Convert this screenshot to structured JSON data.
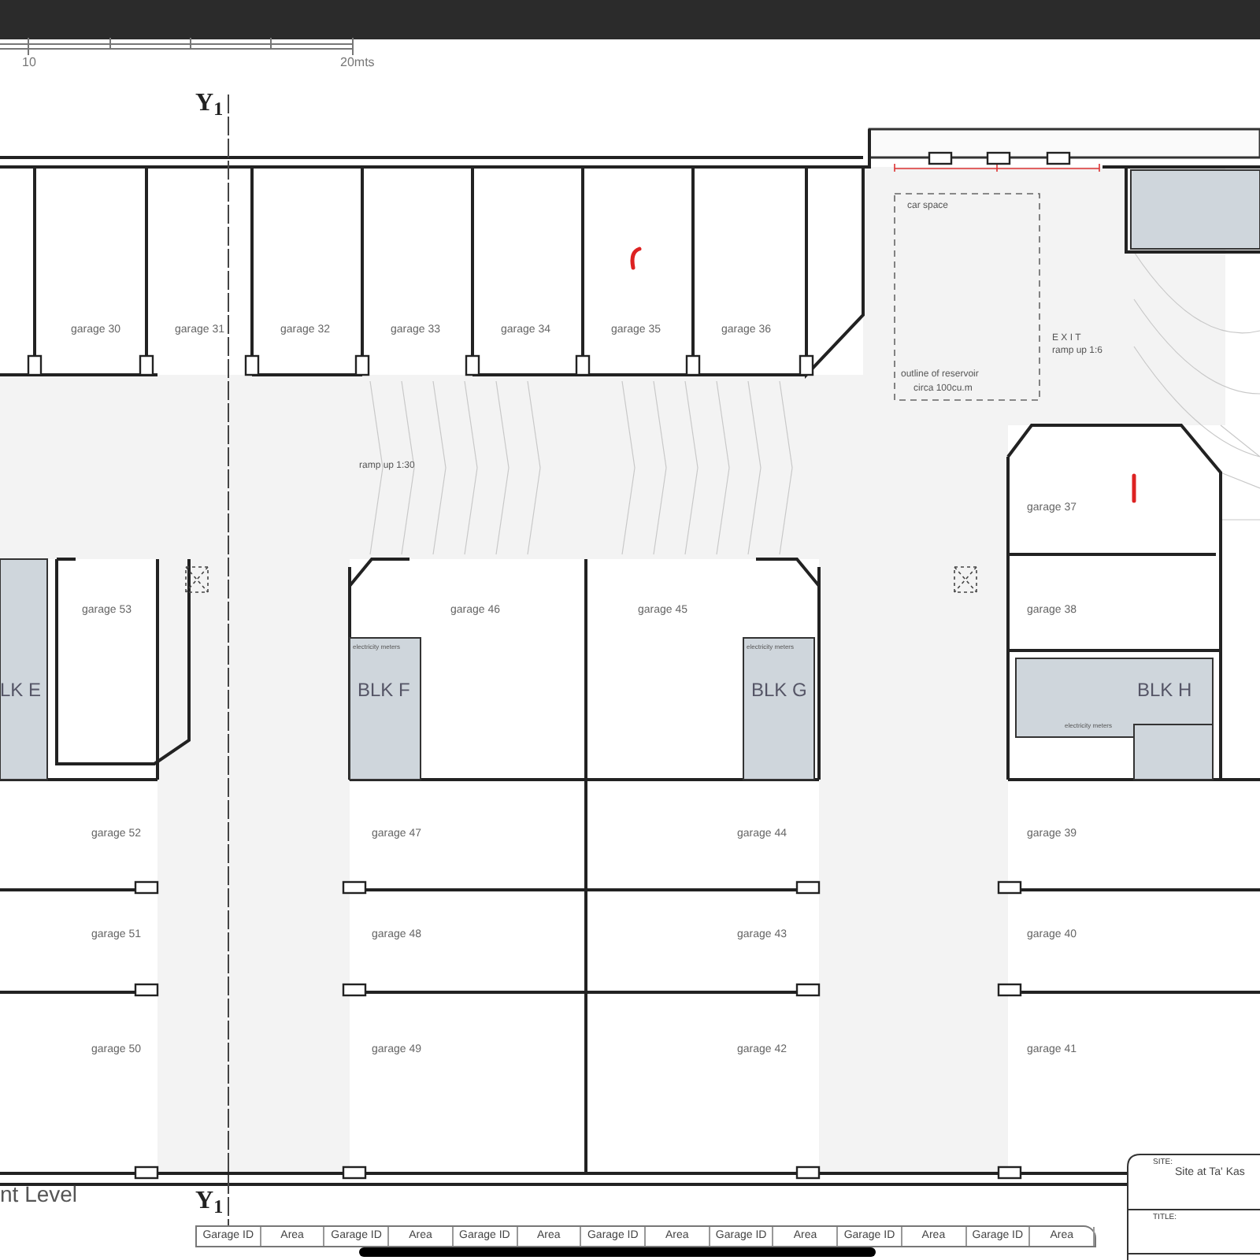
{
  "scale_bar": {
    "labels": [
      "10",
      "20mts"
    ]
  },
  "axis_markers": [
    "Y$_{1}$",
    "Y$_{1}$"
  ],
  "garages": [
    "garage 30",
    "garage 31",
    "garage 32",
    "garage 33",
    "garage 34",
    "garage 35",
    "garage 36",
    "garage 37",
    "garage 53",
    "garage 46",
    "garage 45",
    "garage 38",
    "garage 52",
    "garage 47",
    "garage 44",
    "garage 39",
    "garage 51",
    "garage 48",
    "garage 43",
    "garage 40",
    "garage 50",
    "garage 49",
    "garage 42",
    "garage 41"
  ],
  "blocks": [
    "LK E",
    "BLK F",
    "BLK G",
    "BLK H"
  ],
  "notes": [
    "ramp up 1:30",
    "car space",
    "outline of reservoir",
    "circa 100cu.m",
    "E X I T",
    "ramp up 1:6",
    "electricity meters",
    "electricity meters",
    "electricity meters"
  ],
  "level_title": "nt Level",
  "area_table": {
    "columns": [
      "Garage ID",
      "Area",
      "Garage ID",
      "Area",
      "Garage ID",
      "Area",
      "Garage ID",
      "Area",
      "Garage ID",
      "Area",
      "Garage ID",
      "Area",
      "Garage ID",
      "Area"
    ]
  },
  "title_block": {
    "fields": [
      {
        "label": "SITE:",
        "value": "Site at Ta' Kas"
      },
      {
        "label": "TITLE:"
      }
    ]
  }
}
